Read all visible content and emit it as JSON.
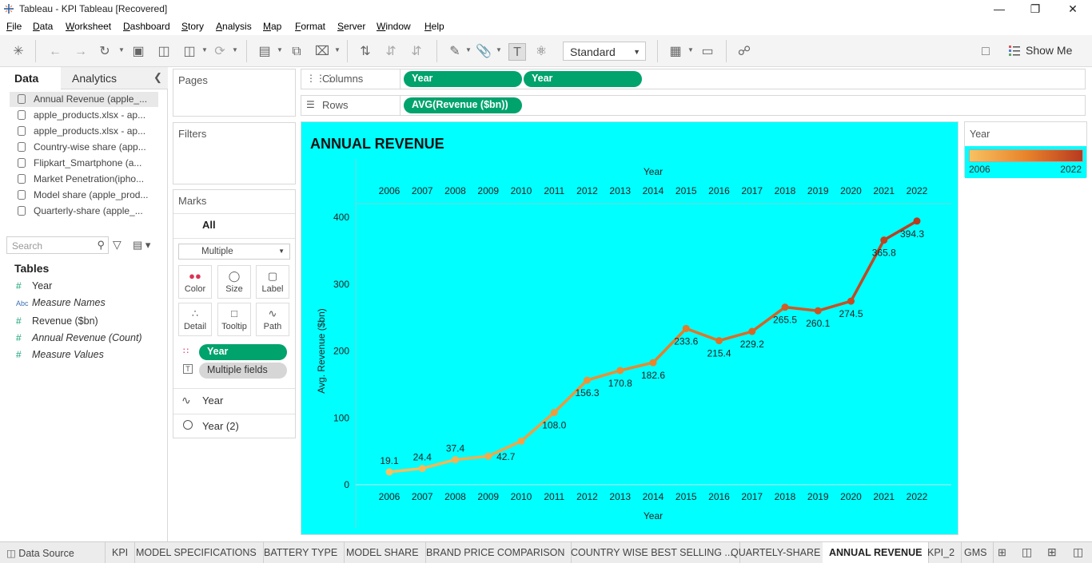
{
  "window": {
    "title": "Tableau - KPI Tableau [Recovered]"
  },
  "menu": [
    "File",
    "Data",
    "Worksheet",
    "Dashboard",
    "Story",
    "Analysis",
    "Map",
    "Format",
    "Server",
    "Window",
    "Help"
  ],
  "toolbar": {
    "fit_select": "Standard",
    "show_me": "Show Me"
  },
  "data_pane": {
    "tabs": {
      "data": "Data",
      "analytics": "Analytics"
    },
    "sources": [
      "Annual Revenue (apple_...",
      "apple_products.xlsx - ap...",
      "apple_products.xlsx - ap...",
      "Country-wise share (app...",
      "Flipkart_Smartphone (a...",
      "Market Penetration(ipho...",
      "Model share (apple_prod...",
      "Quarterly-share (apple_..."
    ],
    "search_placeholder": "Search",
    "tables_heading": "Tables",
    "fields": [
      {
        "icon": "#",
        "label": "Year"
      },
      {
        "icon": "Abc",
        "label": "Measure Names"
      },
      {
        "icon": "#",
        "label": "Revenue ($bn)"
      },
      {
        "icon": "#",
        "label": "Annual Revenue (Count)"
      },
      {
        "icon": "#",
        "label": "Measure Values"
      }
    ]
  },
  "cards": {
    "pages": "Pages",
    "filters": "Filters",
    "marks": "Marks",
    "marks_all": "All",
    "mark_type": "Multiple",
    "mark_buttons": [
      "Color",
      "Size",
      "Label",
      "Detail",
      "Tooltip",
      "Path"
    ],
    "mark_pills": [
      "Year",
      "Multiple fields"
    ],
    "mark_layers": [
      "Year",
      "Year (2)"
    ]
  },
  "shelves": {
    "columns_label": "Columns",
    "columns_pills": [
      "Year",
      "Year"
    ],
    "rows_label": "Rows",
    "rows_pills": [
      "AVG(Revenue ($bn))"
    ]
  },
  "chart_data": {
    "type": "line",
    "title": "ANNUAL REVENUE",
    "xlabel": "Year",
    "ylabel": "Avg. Revenue ($bn)",
    "x": [
      2006,
      2007,
      2008,
      2009,
      2010,
      2011,
      2012,
      2013,
      2014,
      2015,
      2016,
      2017,
      2018,
      2019,
      2020,
      2021,
      2022
    ],
    "y": [
      19.1,
      24.4,
      37.4,
      42.7,
      65.2,
      108.0,
      156.3,
      170.8,
      182.6,
      233.6,
      215.4,
      229.2,
      265.5,
      260.1,
      274.5,
      365.8,
      394.3
    ],
    "data_labels": [
      "19.1",
      "24.4",
      "37.4",
      "42.7",
      "",
      "108.0",
      "156.3",
      "170.8",
      "182.6",
      "233.6",
      "215.4",
      "229.2",
      "265.5",
      "260.1",
      "274.5",
      "365.8",
      "394.3"
    ],
    "y_ticks": [
      0,
      100,
      200,
      300,
      400
    ],
    "ylim": [
      0,
      420
    ],
    "background": "#00FFFF",
    "color_low": "#F7C160",
    "color_high": "#B83A20"
  },
  "legend": {
    "title": "Year",
    "min": "2006",
    "max": "2022"
  },
  "sheet_tabs": [
    "Data Source",
    "KPI",
    "MODEL SPECIFICATIONS",
    "BATTERY TYPE",
    "MODEL SHARE",
    "BRAND PRICE COMPARISON",
    "COUNTRY WISE BEST SELLING ...",
    "QUARTELY-SHARE",
    "ANNUAL REVENUE",
    "KPI_2",
    "GMS"
  ],
  "active_tab": "ANNUAL REVENUE"
}
